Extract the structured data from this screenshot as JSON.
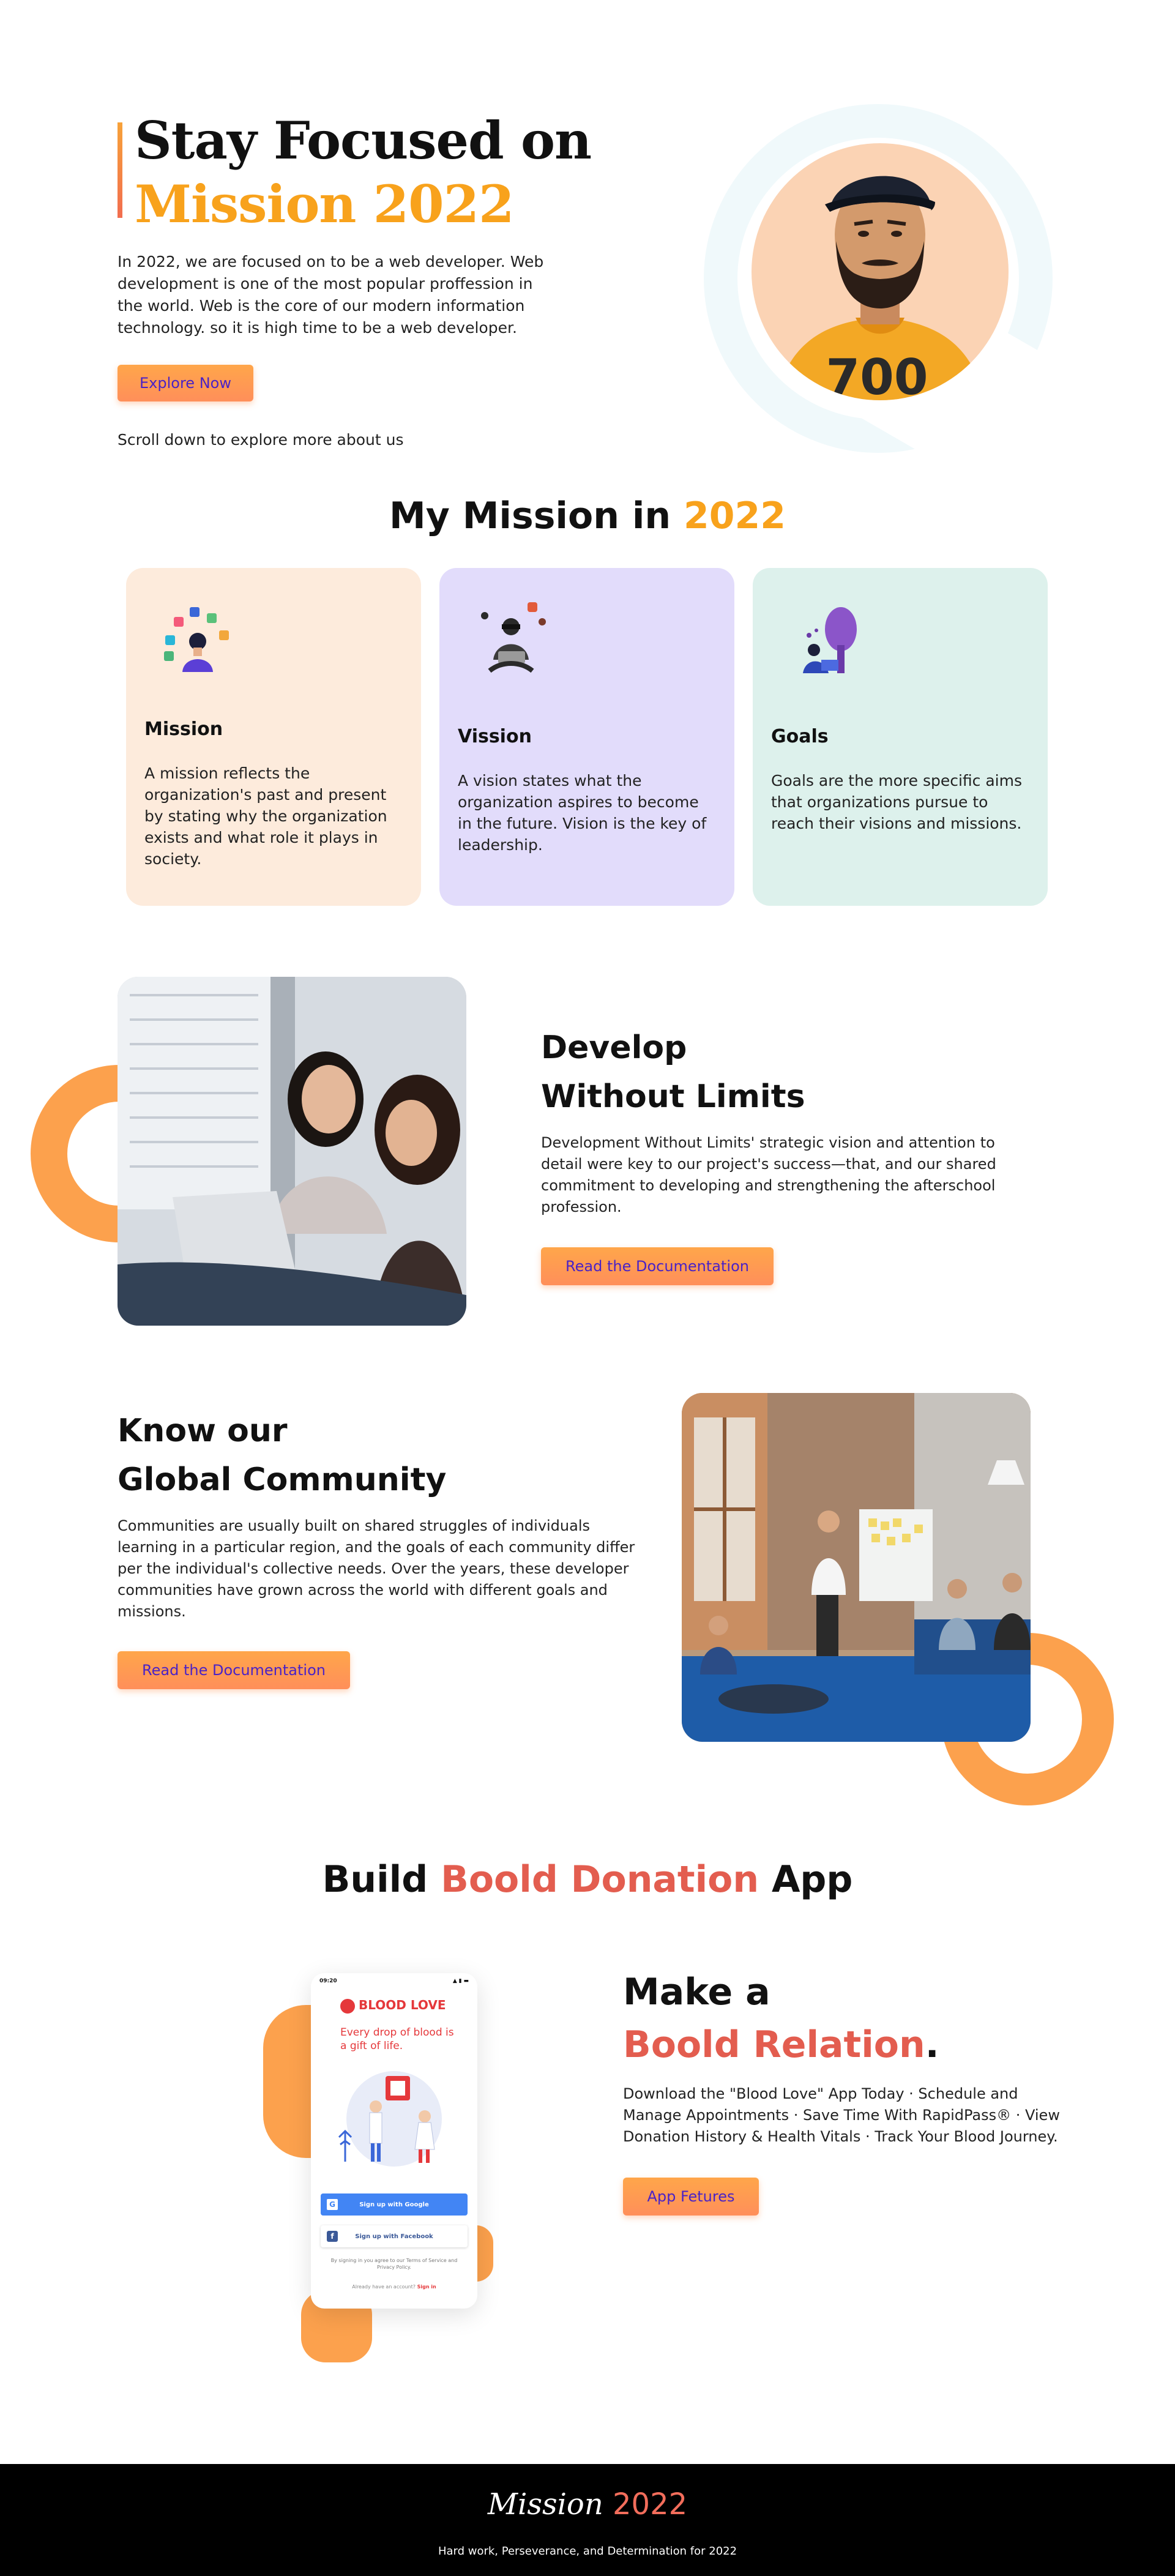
{
  "hero": {
    "title_line1": "Stay Focused on",
    "title_line2": "Mission 2022",
    "description": "In 2022, we are focused on to be a web developer. Web development is one of the most popular proffession in the world. Web is the core of our modern information technology. so it is high time to be a web developer.",
    "cta_label": "Explore Now",
    "scroll_hint": "Scroll down to explore more about us",
    "shirt_text": "700"
  },
  "mission": {
    "title_main": "My Mission in ",
    "title_accent": "2022",
    "cards": [
      {
        "title": "Mission",
        "text": "A mission reflects the organization's past and present by stating why the organization exists and what role it plays in society.",
        "icon": "mission-illustration-icon"
      },
      {
        "title": "Vission",
        "text": "A vision states what the organization aspires to become in the future. Vision is the key of leadership.",
        "icon": "vision-illustration-icon"
      },
      {
        "title": "Goals",
        "text": "Goals are the more specific aims that organizations pursue to reach their visions and missions.",
        "icon": "goals-illustration-icon"
      }
    ]
  },
  "develop": {
    "title_line1": "Develop",
    "title_line2": "Without Limits",
    "text": "Development Without Limits' strategic vision and attention to detail were key to our project's success—that, and our shared commitment to developing and strengthening the afterschool profession.",
    "cta_label": "Read the Documentation"
  },
  "community": {
    "title_line1": "Know our",
    "title_line2": "Global Community",
    "text": "Communities are usually built on shared struggles of individuals learning in a particular region, and the goals of each community differ per the individual's collective needs. Over the years, these developer communities have grown across the world with different goals and missions.",
    "cta_label": "Read the Documentation"
  },
  "blood": {
    "title_pre": "Build ",
    "title_accent": "Boold Donation",
    "title_post": " App",
    "phone": {
      "time": "09:20",
      "signal": "▲ ▮ ▬",
      "logo": "BLOOD LOVE",
      "tagline": "Every drop of blood is a gift of life.",
      "google_label": "Sign up with Google",
      "facebook_label": "Sign up with Facebook",
      "terms": "By signing in you agree to our Terms of Service and Privacy Policy.",
      "signin_prompt": "Already have an account?",
      "signin_link": "Sign in"
    },
    "make_line1": "Make a",
    "make_accent": "Boold Relation",
    "make_dot": ".",
    "text": "Download the \"Blood Love\" App Today · Schedule and Manage Appointments · Save Time With RapidPass® · View Donation History & Health Vitals · Track Your Blood Journey.",
    "cta_label": "App Fetures"
  },
  "footer": {
    "logo_script": "Mission",
    "logo_year": "2022",
    "tagline": "Hard work, Perseverance, and Determination for 2022"
  },
  "colors": {
    "accent_yellow": "#f8a21c",
    "accent_orange": "#fca14d",
    "accent_red": "#e35d4f",
    "button_text": "#4a22c6"
  }
}
